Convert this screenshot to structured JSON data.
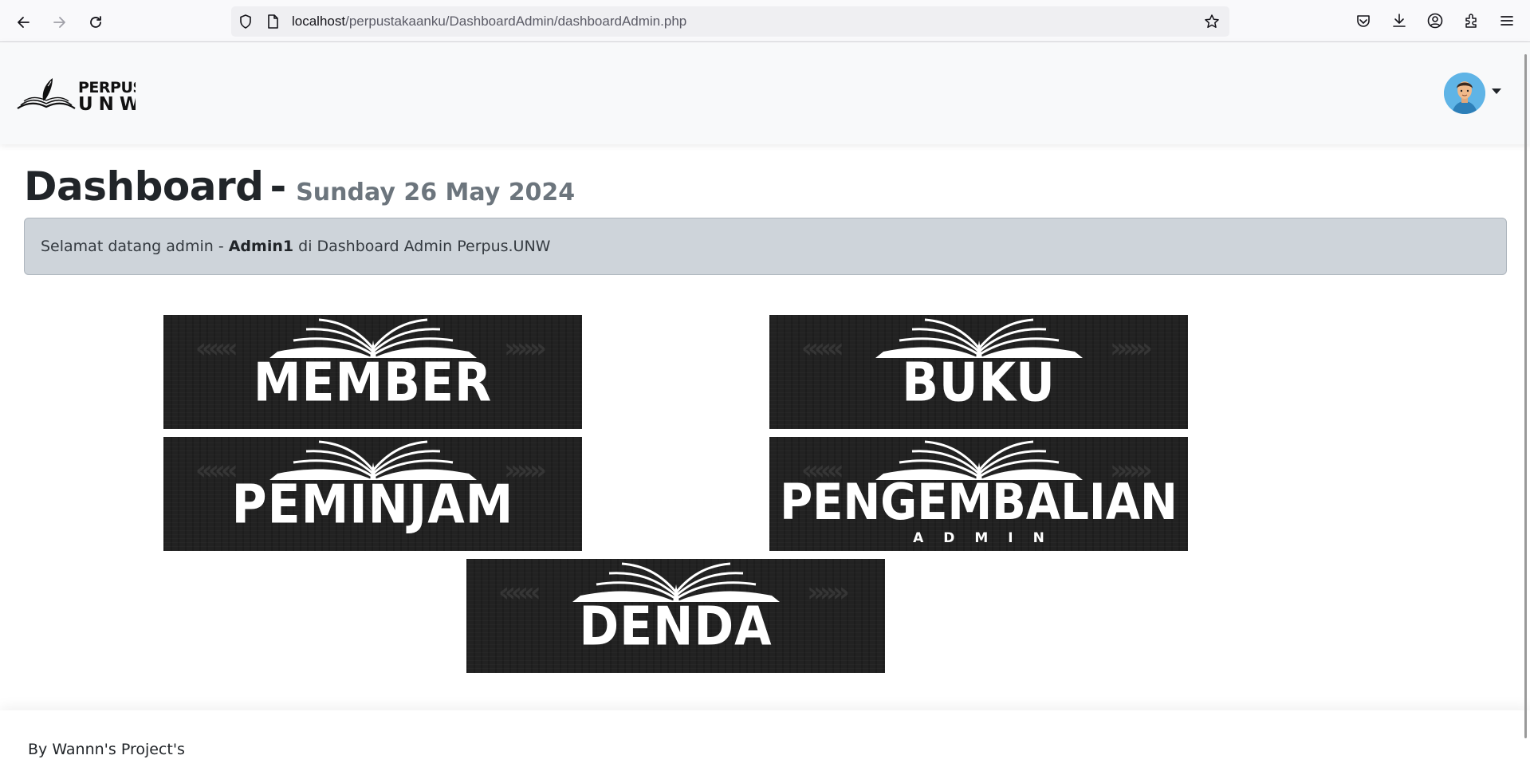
{
  "browser": {
    "url_host": "localhost",
    "url_path": "/perpustakaanku/DashboardAdmin/dashboardAdmin.php",
    "icons": [
      "back-icon",
      "forward-icon",
      "reload-icon",
      "shield-icon",
      "page-icon",
      "bookmark-star-icon",
      "pocket-icon",
      "download-icon",
      "account-icon",
      "extensions-icon",
      "menu-icon"
    ]
  },
  "navbar": {
    "logo_text_top": "PERPUS",
    "logo_text_bottom": "UNW"
  },
  "main": {
    "title": "Dashboard",
    "separator": "-",
    "date": "Sunday 26 May 2024",
    "welcome": {
      "prefix": "Selamat datang admin - ",
      "username": "Admin1",
      "suffix": " di Dashboard Admin Perpus.UNW"
    },
    "menu": {
      "member": "MEMBER",
      "buku": "BUKU",
      "peminjam": "PEMINJAM",
      "pengembalian": "PENGEMBALIAN",
      "pengembalian_sub": "ADMIN",
      "denda": "DENDA"
    }
  },
  "footer": {
    "text": "By Wannn's Project's"
  },
  "colors": {
    "banner_bg": "#222222",
    "alert_bg": "#ced4da",
    "date_color": "#6c757d"
  }
}
